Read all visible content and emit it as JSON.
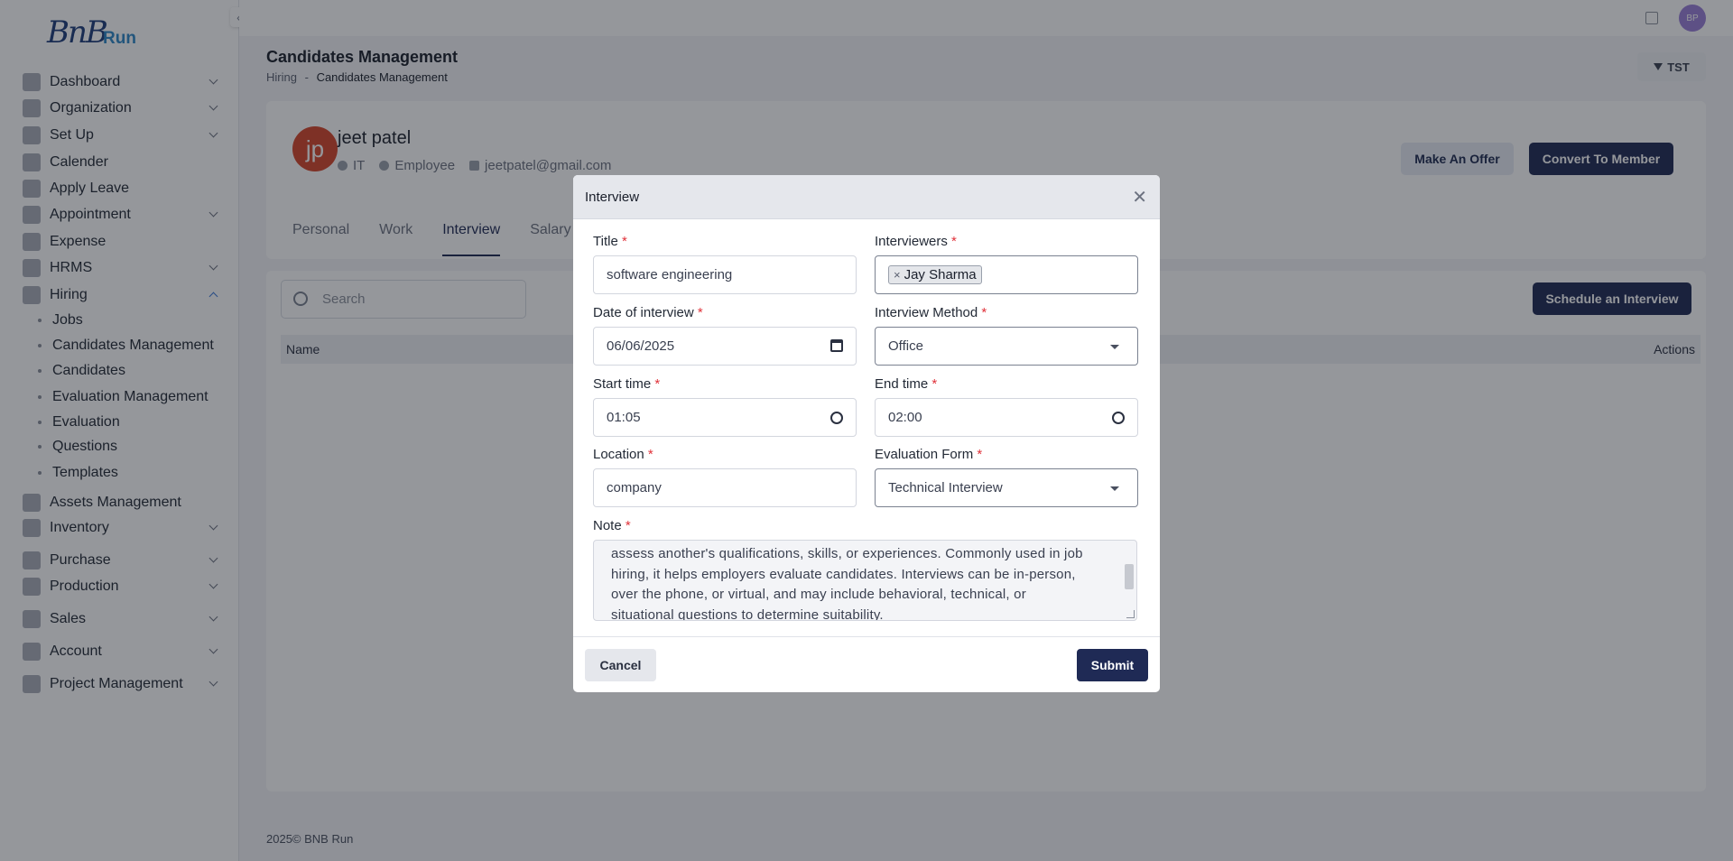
{
  "app": {
    "logo_text": "BnB",
    "logo_sub": "Run",
    "user_initials": "BP"
  },
  "sidebar": {
    "items": [
      {
        "label": "Dashboard",
        "icon": "dashboard-icon",
        "expandable": true
      },
      {
        "label": "Organization",
        "icon": "document-icon",
        "expandable": true
      },
      {
        "label": "Set Up",
        "icon": "settings-icon",
        "expandable": true
      },
      {
        "label": "Calender",
        "icon": "hourglass-icon",
        "expandable": false
      },
      {
        "label": "Apply Leave",
        "icon": "leave-icon",
        "expandable": false
      },
      {
        "label": "Appointment",
        "icon": "calendar-icon",
        "expandable": true
      },
      {
        "label": "Expense",
        "icon": "money-icon",
        "expandable": false
      },
      {
        "label": "HRMS",
        "icon": "id-card-icon",
        "expandable": true
      },
      {
        "label": "Hiring",
        "icon": "hiring-icon",
        "expandable": true,
        "expanded": true
      }
    ],
    "hiring_sub": [
      "Jobs",
      "Candidates Management",
      "Candidates",
      "Evaluation Management",
      "Evaluation",
      "Questions",
      "Templates"
    ],
    "items_after": [
      {
        "label": "Assets Management",
        "icon": "assets-icon",
        "expandable": false
      },
      {
        "label": "Inventory",
        "icon": "inventory-icon",
        "expandable": true
      },
      {
        "label": "Purchase",
        "icon": "cart-icon",
        "expandable": true
      },
      {
        "label": "Production",
        "icon": "production-icon",
        "expandable": true
      },
      {
        "label": "Sales",
        "icon": "sales-icon",
        "expandable": true
      },
      {
        "label": "Account",
        "icon": "account-icon",
        "expandable": true
      },
      {
        "label": "Project Management",
        "icon": "project-icon",
        "expandable": true
      }
    ]
  },
  "page": {
    "title": "Candidates Management",
    "breadcrumb_root": "Hiring",
    "breadcrumb_sep": "-",
    "breadcrumb_current": "Candidates Management",
    "filter_label": "TST"
  },
  "candidate": {
    "initials": "jp",
    "name": "jeet patel",
    "department": "IT",
    "type": "Employee",
    "email": "jeetpatel@gmail.com",
    "offer_label": "Make An Offer",
    "convert_label": "Convert To Member",
    "tabs": [
      "Personal",
      "Work",
      "Interview",
      "Salary"
    ],
    "active_tab": "Interview"
  },
  "table": {
    "search_placeholder": "Search",
    "schedule_label": "Schedule an Interview",
    "col_name": "Name",
    "col_actions": "Actions"
  },
  "footer": {
    "text": "2025© BNB Run"
  },
  "modal": {
    "title": "Interview",
    "required_mark": "*",
    "title_label": "Title",
    "title_value": "software engineering",
    "interviewers_label": "Interviewers",
    "interviewer_tag": "Jay Sharma",
    "tag_remove": "×",
    "date_label": "Date of interview",
    "date_value": "06/06/2025",
    "method_label": "Interview Method",
    "method_value": "Office",
    "start_label": "Start time",
    "start_value": "01:05",
    "end_label": "End time",
    "end_value": "02:00",
    "location_label": "Location",
    "location_value": "company",
    "eval_label": "Evaluation Form",
    "eval_value": "Technical Interview",
    "note_label": "Note",
    "note_lines": [
      "assess another's qualifications, skills, or experiences. Commonly used in job",
      "hiring, it helps employers evaluate candidates. Interviews can be in-person,",
      "over the phone, or virtual, and may include behavioral, technical, or",
      "situational questions to determine suitability."
    ],
    "cancel_label": "Cancel",
    "submit_label": "Submit",
    "close_glyph": "✕"
  }
}
